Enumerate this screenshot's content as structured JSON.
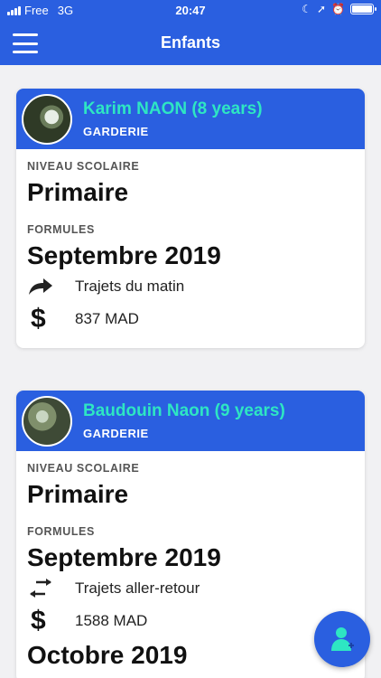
{
  "status_bar": {
    "carrier": "Free",
    "network": "3G",
    "time": "20:47"
  },
  "app_bar": {
    "title": "Enfants",
    "menu_icon": "hamburger-menu-icon"
  },
  "children": [
    {
      "name": "Karim NAON (8 years)",
      "category": "GARDERIE",
      "level_label": "NIVEAU SCOLAIRE",
      "level": "Primaire",
      "formulas_label": "FORMULES",
      "formula_period": "Septembre 2019",
      "trip_icon": "share-arrow-icon",
      "trip": "Trajets du matin",
      "price_icon": "dollar-icon",
      "price": "837 MAD"
    },
    {
      "name": "Baudouin Naon (9 years)",
      "category": "GARDERIE",
      "level_label": "NIVEAU SCOLAIRE",
      "level": "Primaire",
      "formulas_label": "FORMULES",
      "formula_period": "Septembre 2019",
      "trip_icon": "swap-arrows-icon",
      "trip": "Trajets aller-retour",
      "price_icon": "dollar-icon",
      "price": "1588 MAD",
      "next_period": "Octobre 2019"
    }
  ],
  "colors": {
    "primary": "#2a5fe0",
    "name_accent": "#2ee6c3",
    "fab_icon": "#2ee6c3"
  },
  "fab": {
    "icon": "add-user-icon"
  }
}
